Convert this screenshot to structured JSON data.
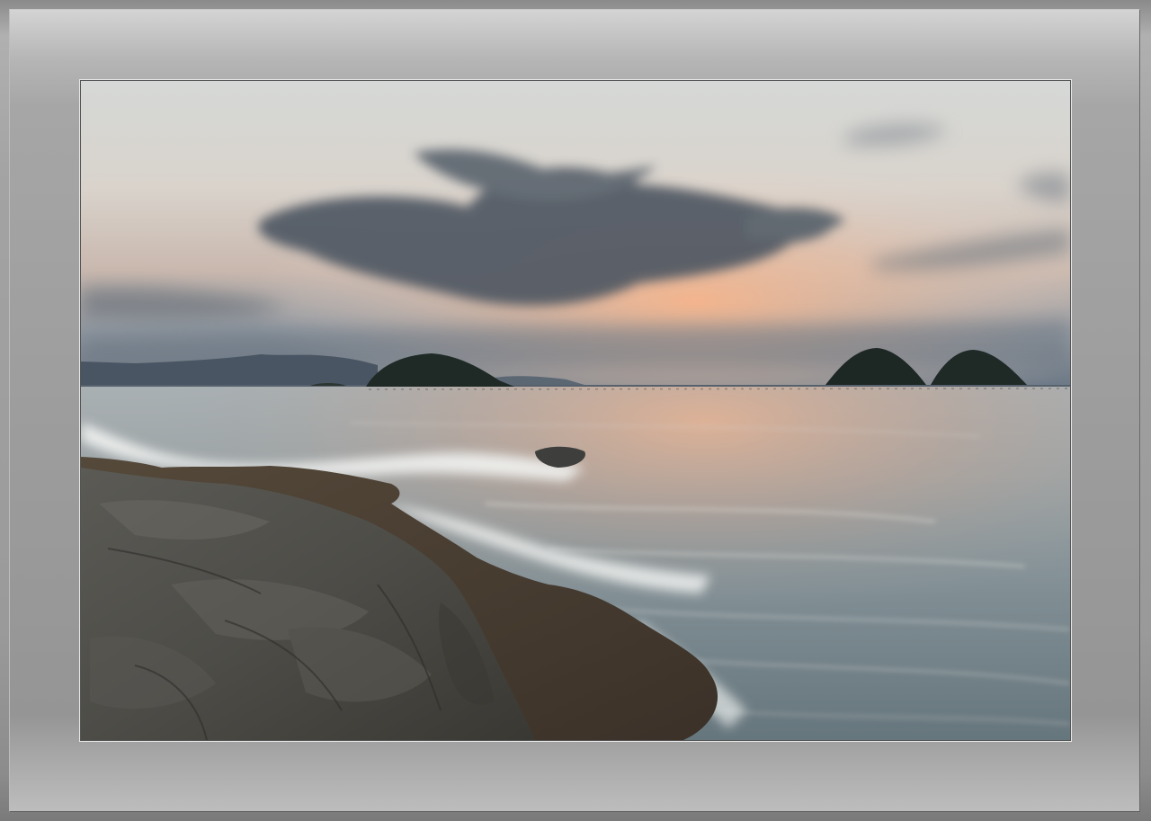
{
  "scene": {
    "subject": "coastal-sunset-seascape",
    "colors": {
      "frame_gray": "#9d9d9d",
      "sky_top": "#d6d6d2",
      "sky_glow": "#f2b892",
      "cloud": "#4b545e",
      "sea": "#8c9aa0",
      "rock": "#4a4a46"
    }
  }
}
